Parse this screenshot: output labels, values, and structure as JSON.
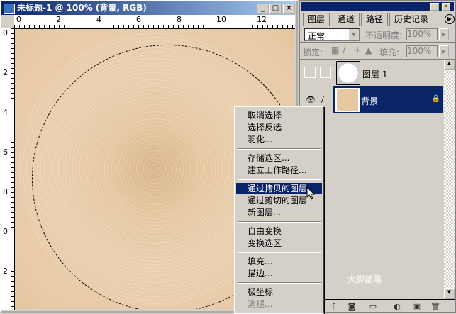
{
  "document": {
    "title": "未标题-1 @ 100% (背景, RGB)",
    "ruler_top": [
      "0",
      "2",
      "4",
      "6",
      "8",
      "10",
      "12"
    ],
    "ruler_left": [
      "0",
      "2",
      "4",
      "6",
      "8",
      "0",
      "2"
    ],
    "buttons": {
      "minimize": "_",
      "maximize": "□",
      "close": "×"
    }
  },
  "panel": {
    "tabs": [
      "图层",
      "通道",
      "路径",
      "历史记录"
    ],
    "blend_mode": "正常",
    "opacity_label": "不透明度:",
    "opacity_value": "100%",
    "lock_label": "锁定:",
    "fill_label": "填充:",
    "fill_value": "100%",
    "layers": [
      {
        "name": "图层 1",
        "selected": false
      },
      {
        "name": "背景",
        "selected": true
      }
    ]
  },
  "context_menu": {
    "groups": [
      [
        "取消选择",
        "选择反选",
        "羽化..."
      ],
      [
        "存储选区...",
        "建立工作路径..."
      ],
      [
        "通过拷贝的图层",
        "通过剪切的图层",
        "新图层..."
      ],
      [
        "自由变换",
        "变换选区"
      ],
      [
        "填充...",
        "描边..."
      ],
      [
        "极坐标",
        "消褪..."
      ]
    ],
    "selected": "通过拷贝的图层",
    "disabled": "消褪..."
  },
  "watermark": "大脚部落",
  "colors": {
    "titlebar": "#0a246a",
    "selection": "#0a246a",
    "canvas": "#e6c8a2"
  }
}
